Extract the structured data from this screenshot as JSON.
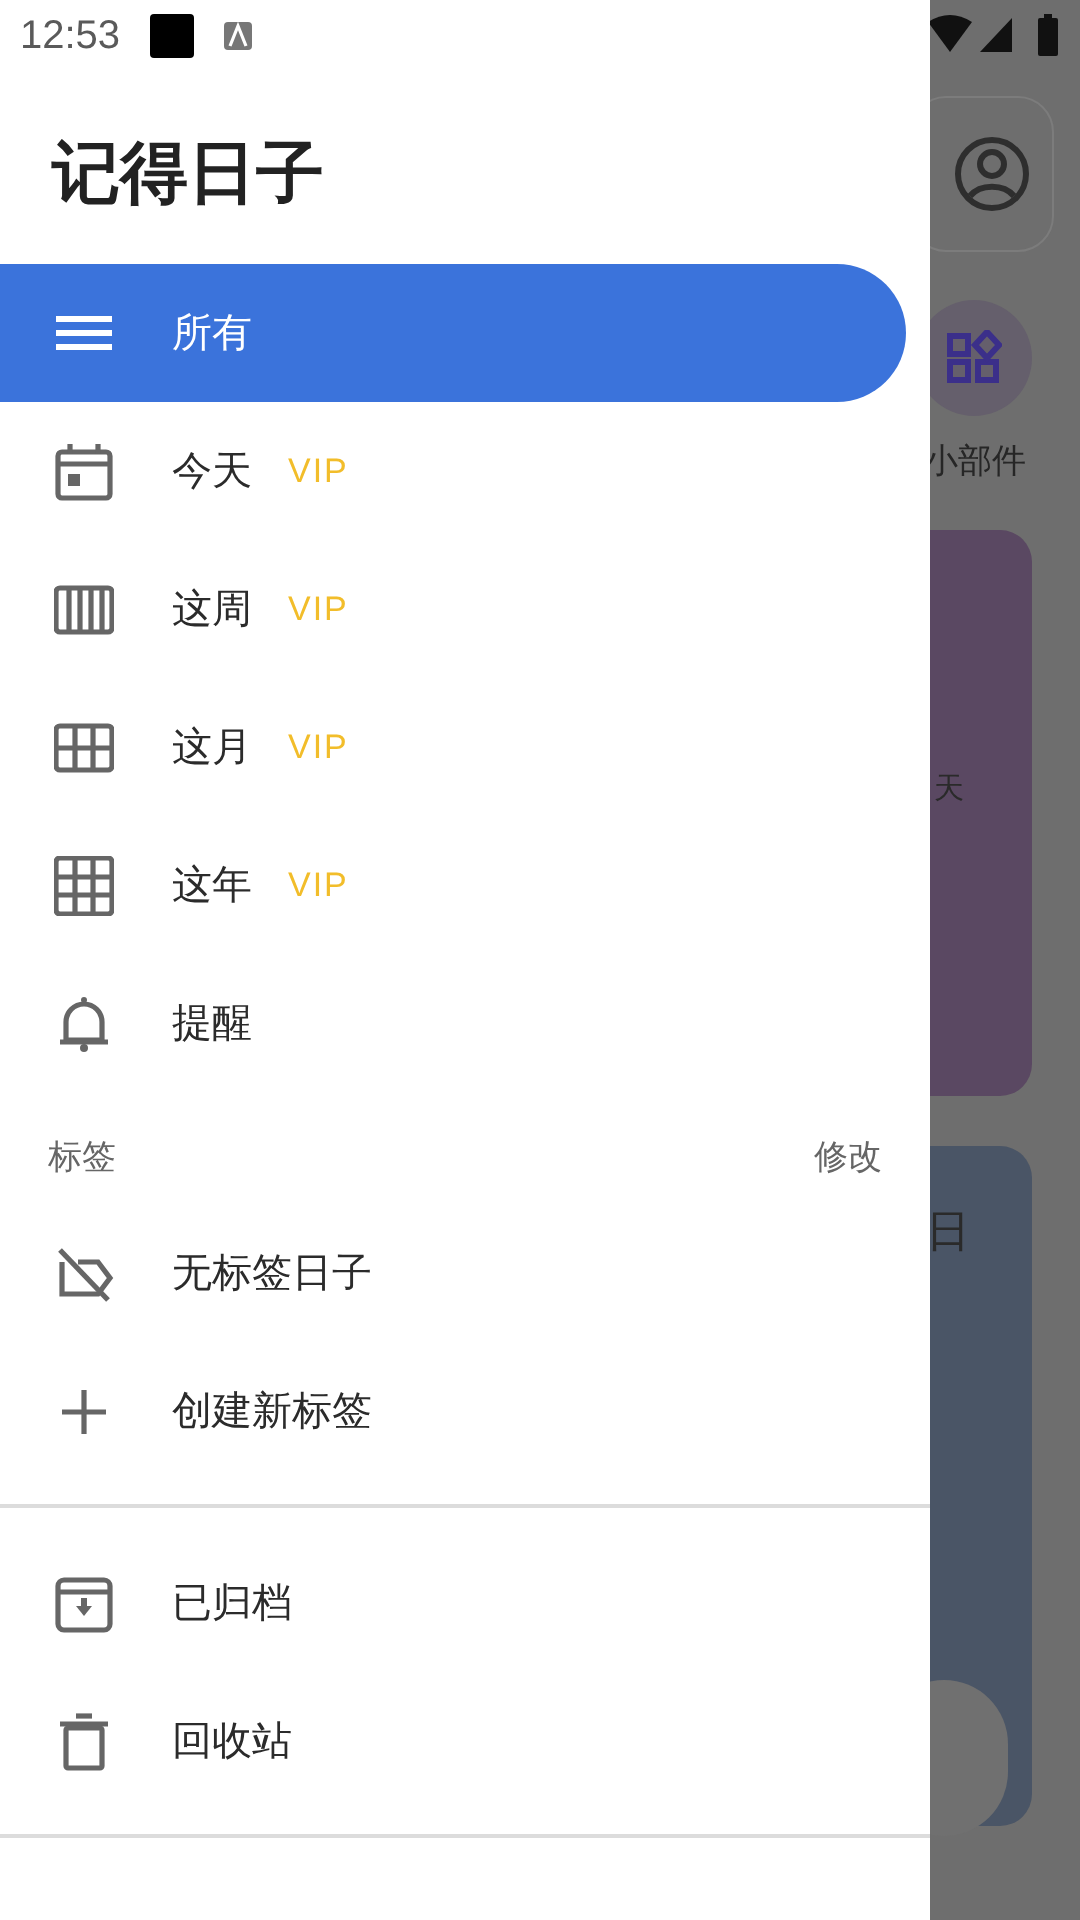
{
  "status_bar": {
    "time": "12:53"
  },
  "drawer": {
    "title": "记得日子",
    "nav_items": [
      {
        "kind": "list",
        "label": "所有",
        "selected": true
      },
      {
        "kind": "day",
        "label": "今天",
        "badge": "VIP",
        "selected": false
      },
      {
        "kind": "week",
        "label": "这周",
        "badge": "VIP",
        "selected": false
      },
      {
        "kind": "month",
        "label": "这月",
        "badge": "VIP",
        "selected": false
      },
      {
        "kind": "year",
        "label": "这年",
        "badge": "VIP",
        "selected": false
      },
      {
        "kind": "bell",
        "label": "提醒",
        "selected": false
      }
    ],
    "tags_section": {
      "title": "标签",
      "action": "修改"
    },
    "tag_items": [
      {
        "kind": "untagged",
        "label": "无标签日子"
      },
      {
        "kind": "plus",
        "label": "创建新标签"
      }
    ],
    "bottom_items": [
      {
        "kind": "archive",
        "label": "已归档"
      },
      {
        "kind": "trash",
        "label": "回收站"
      }
    ]
  },
  "background": {
    "widget_label": "小部件",
    "card_1_text": "天",
    "card_2_text": "日"
  }
}
